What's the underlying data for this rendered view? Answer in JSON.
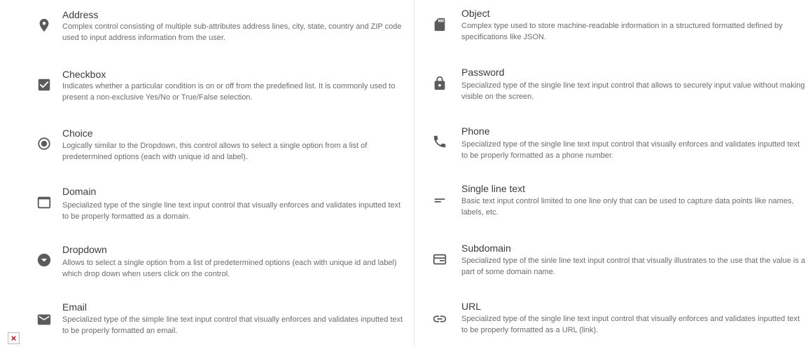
{
  "left_items": [
    {
      "title": "Address",
      "icon": "location-pin-icon",
      "description": "Complex control consisting of multiple sub-attributes address lines, city, state, country and ZIP code used to input address information from the user."
    },
    {
      "title": "Checkbox",
      "icon": "checkbox-icon",
      "description": "Indicates whether a particular condition is on or off from the predefined list. It is commonly used to present a non-exclusive Yes/No or True/False selection."
    },
    {
      "title": "Choice",
      "icon": "radio-button-icon",
      "description": "Logically similar to the Dropdown, this control allows to select a single option from a list of predetermined options (each with unique id and label)."
    },
    {
      "title": "Domain",
      "icon": "browser-window-icon",
      "description": "Specialized type of the single line text input control that visually enforces and validates inputted text to be properly formatted as a domain."
    },
    {
      "title": "Dropdown",
      "icon": "dropdown-circle-icon",
      "description": "Allows to select a single option from a list of predetermined options (each with unique id and label) which drop down when users click on the control."
    },
    {
      "title": "Email",
      "icon": "envelope-icon",
      "description": "Specialized type of the simple line text input control that visually enforces and validates inputted text to be properly formatted an email."
    }
  ],
  "right_items": [
    {
      "title": "Object",
      "icon": "sd-card-icon",
      "description": "Complex type used to store machine-readable information in a structured formatted defined by specifications like JSON."
    },
    {
      "title": "Password",
      "icon": "lock-icon",
      "description": "Specialized type of the single line text input control that allows to securely input value without making visible on the screen."
    },
    {
      "title": "Phone",
      "icon": "phone-icon",
      "description": "Specialized type of the single line text input control that visually enforces and validates inputted text to be properly formatted as a phone number."
    },
    {
      "title": "Single line text",
      "icon": "short-text-icon",
      "description": "Basic text input control limited to one line only that can be used to capture data points like names, labels, etc."
    },
    {
      "title": "Subdomain",
      "icon": "web-window-icon",
      "description": "Specialized type of the sinle line text input control that visually illustrates to the use that the value is a part of some domain name."
    },
    {
      "title": "URL",
      "icon": "link-icon",
      "description": "Specialized type of the single line text input control that visually enforces and validates inputted text to be properly formatted as a URL (link)."
    }
  ],
  "broken_image_glyph": "×",
  "colors": {
    "icon": "#5b5b5b",
    "title": "#3b3b3b",
    "description": "#6c6c6c",
    "divider": "#e2e2e2",
    "broken_image": "#d0021b"
  }
}
